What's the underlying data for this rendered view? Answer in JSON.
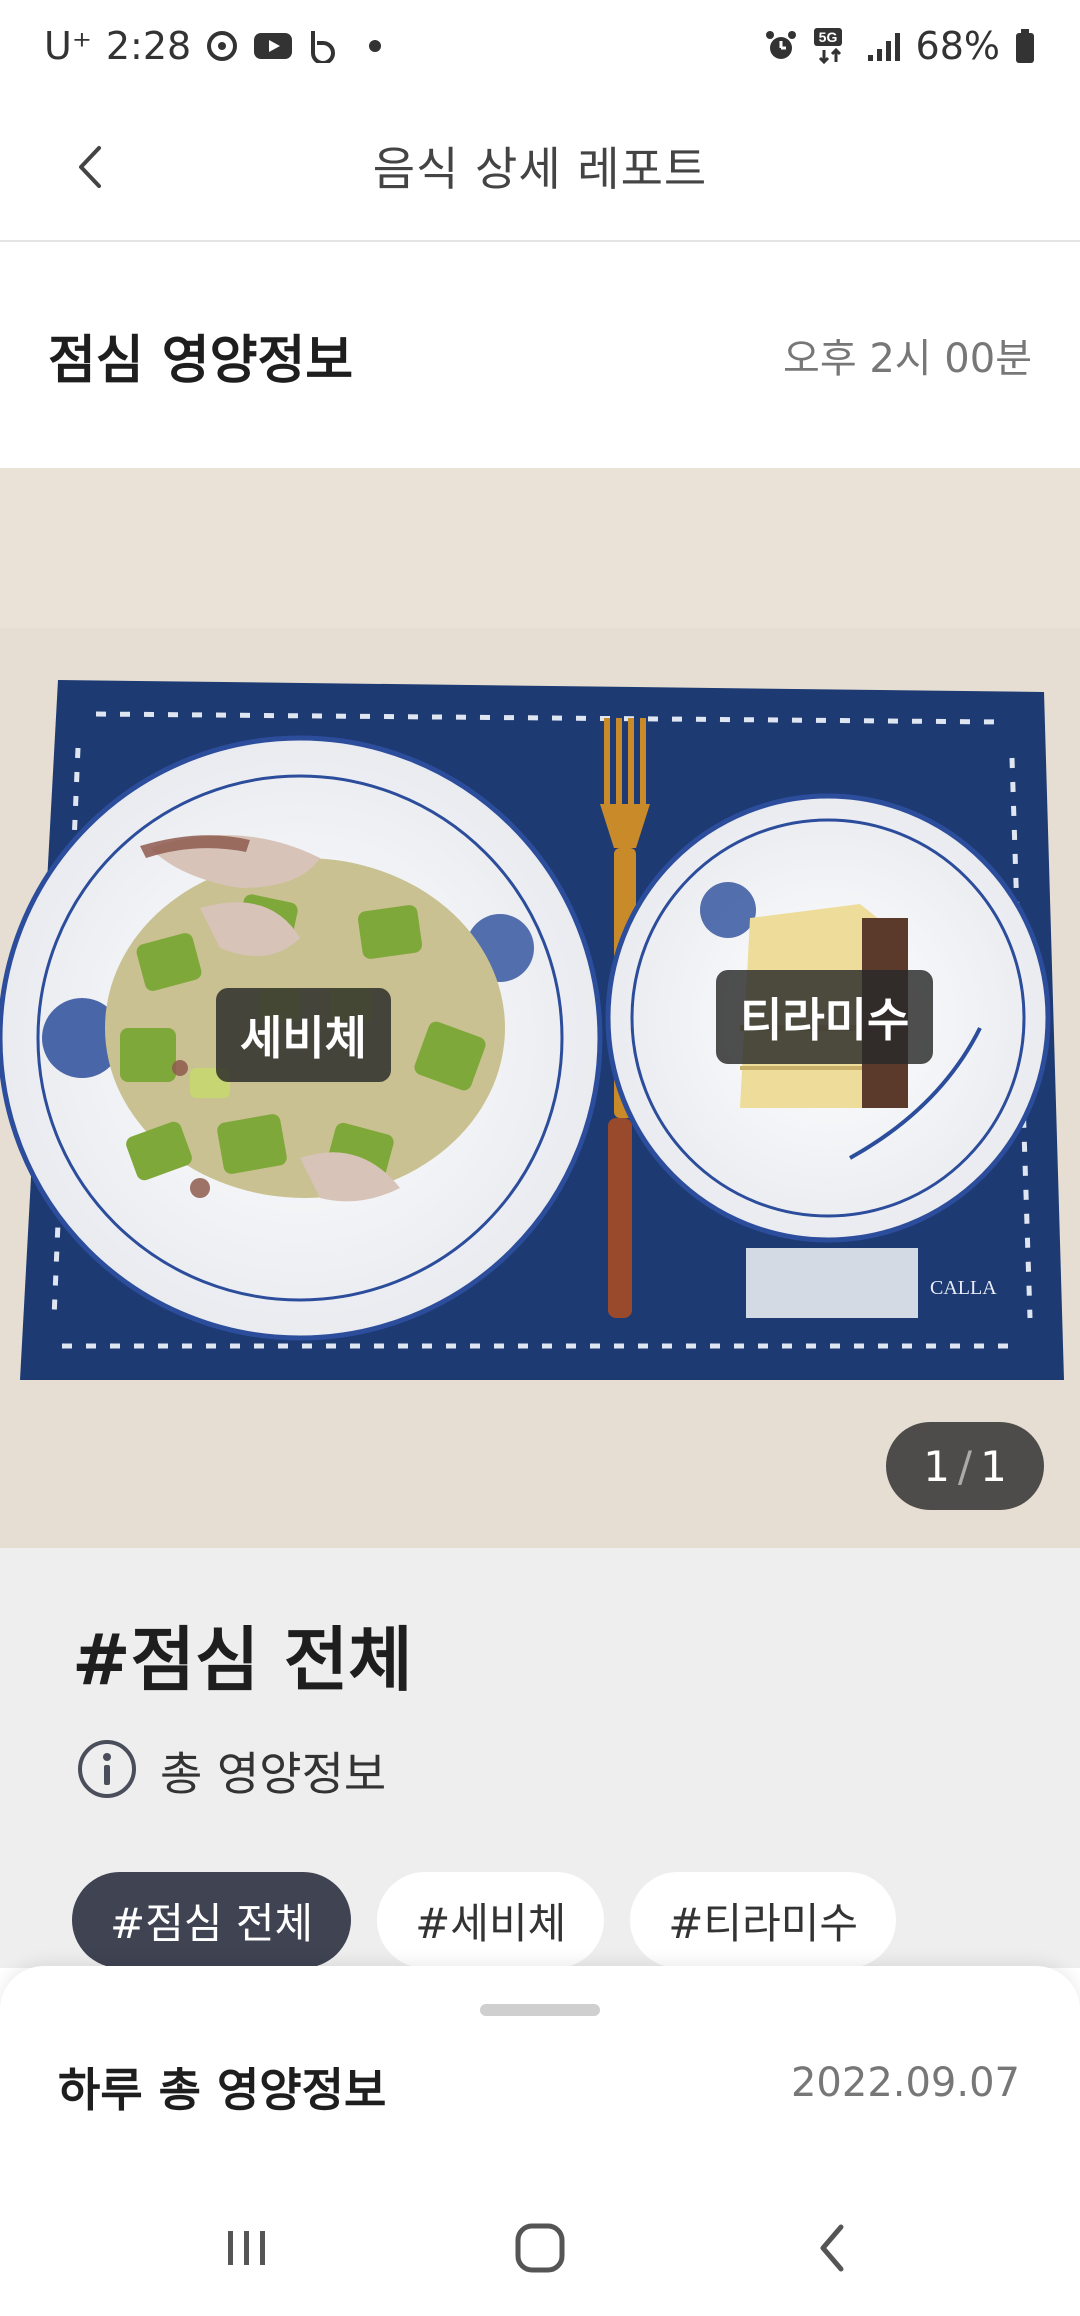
{
  "status_bar": {
    "carrier": "U⁺",
    "time": "2:28",
    "battery": "68%",
    "network": "5G"
  },
  "header": {
    "title": "음식 상세 레포트"
  },
  "meal": {
    "title": "점심 영양정보",
    "time": "오후 2시 00분"
  },
  "photo": {
    "labels": [
      "세비체",
      "티라미수"
    ],
    "placemat_brand": "CALLA",
    "counter": {
      "current": "1",
      "separator": "/",
      "total": "1"
    }
  },
  "section": {
    "title": "#점심 전체",
    "info_text": "총 영양정보",
    "chips": [
      "#점심 전체",
      "#세비체",
      "#티라미수"
    ],
    "active_chip": 0
  },
  "sheet": {
    "title": "하루 총 영양정보",
    "date": "2022.09.07"
  },
  "colors": {
    "chip_active": "#3f4352",
    "placemat": "#1d3a73",
    "section_bg": "#eeeeee"
  },
  "icons": [
    "alarm-icon",
    "signal-icon",
    "battery-icon",
    "back-icon",
    "info-icon",
    "recents-icon",
    "home-icon",
    "nav-back-icon"
  ]
}
